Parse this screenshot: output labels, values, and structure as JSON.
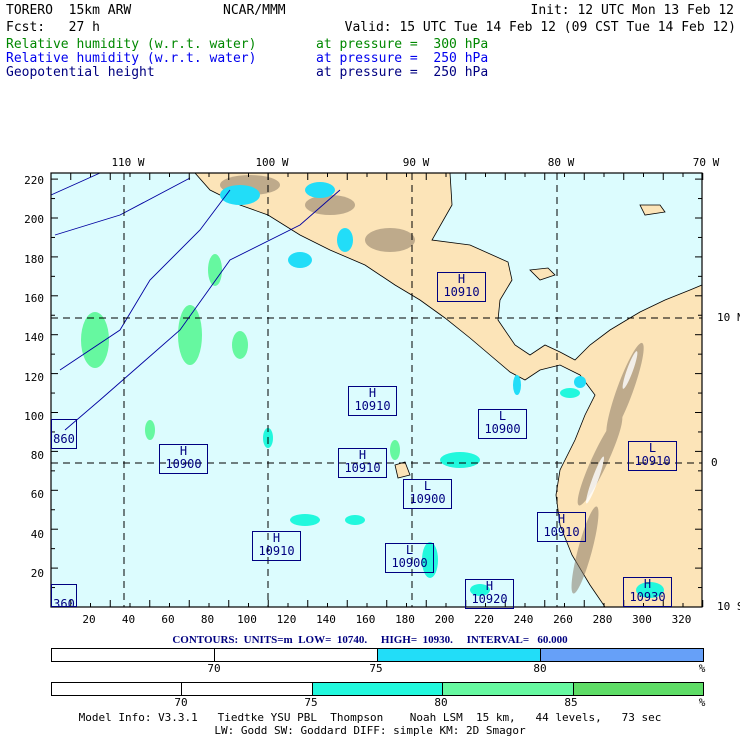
{
  "header": {
    "model": "TORERO  15km ARW",
    "org": "NCAR/MMM",
    "init": "Init: 12 UTC Mon 13 Feb 12",
    "fcst": "Fcst:   27 h",
    "valid": "Valid: 15 UTC Tue 14 Feb 12 (09 CST Tue 14 Feb 12)",
    "fields": [
      {
        "name": "Relative humidity (w.r.t. water)",
        "level": "at pressure =  300 hPa",
        "color": "#008800"
      },
      {
        "name": "Relative humidity (w.r.t. water)",
        "level": "at pressure =  250 hPa",
        "color": "#0000ee"
      },
      {
        "name": "Geopotential height",
        "level": "at pressure =  250 hPa",
        "color": "#000080"
      }
    ]
  },
  "map": {
    "lon_labels": [
      "110 W",
      "100 W",
      "90 W",
      "80 W",
      "70 W"
    ],
    "lat_labels": [
      "10 N",
      "0",
      "10 S"
    ],
    "y_ticks": [
      "220",
      "200",
      "180",
      "160",
      "140",
      "120",
      "100",
      "80",
      "60",
      "40",
      "20"
    ],
    "x_ticks": [
      "20",
      "40",
      "60",
      "80",
      "100",
      "120",
      "140",
      "160",
      "180",
      "200",
      "220",
      "240",
      "260",
      "280",
      "300",
      "320"
    ],
    "systems": [
      {
        "type": "H",
        "value": "10910"
      },
      {
        "type": "H",
        "value": "10910"
      },
      {
        "type": "L",
        "value": "10900"
      },
      {
        "type": "H",
        "value": "10900"
      },
      {
        "type": "H",
        "value": "10910"
      },
      {
        "type": "L",
        "value": "10900"
      },
      {
        "type": "L",
        "value": "10910"
      },
      {
        "type": "H",
        "value": "10910"
      },
      {
        "type": "H",
        "value": "10910"
      },
      {
        "type": "L",
        "value": "10900"
      },
      {
        "type": "H",
        "value": "10920"
      },
      {
        "type": "H",
        "value": "10930"
      },
      {
        "type": "",
        "value": "860"
      },
      {
        "type": "",
        "value": "360"
      }
    ]
  },
  "contours": "CONTOURS:  UNITS=m  LOW=  10740.     HIGH=  10930.     INTERVAL=   60.000",
  "colorbar1": {
    "labels": [
      "70",
      "75",
      "80",
      "%"
    ],
    "colors": [
      "#ffffff",
      "#ffffff",
      "#22ddf8",
      "#66a0f8"
    ]
  },
  "colorbar2": {
    "labels": [
      "70",
      "75",
      "80",
      "85",
      "%"
    ],
    "colors": [
      "#ffffff",
      "#ffffff",
      "#22f8dd",
      "#66f8a0",
      "#5edc66"
    ]
  },
  "footer": {
    "line1": "Model Info: V3.3.1   Tiedtke YSU PBL  Thompson    Noah LSM  15 km,   44 levels,   73 sec",
    "line2": "LW: Godd SW: Goddard DIFF: simple KM: 2D Smagor"
  }
}
